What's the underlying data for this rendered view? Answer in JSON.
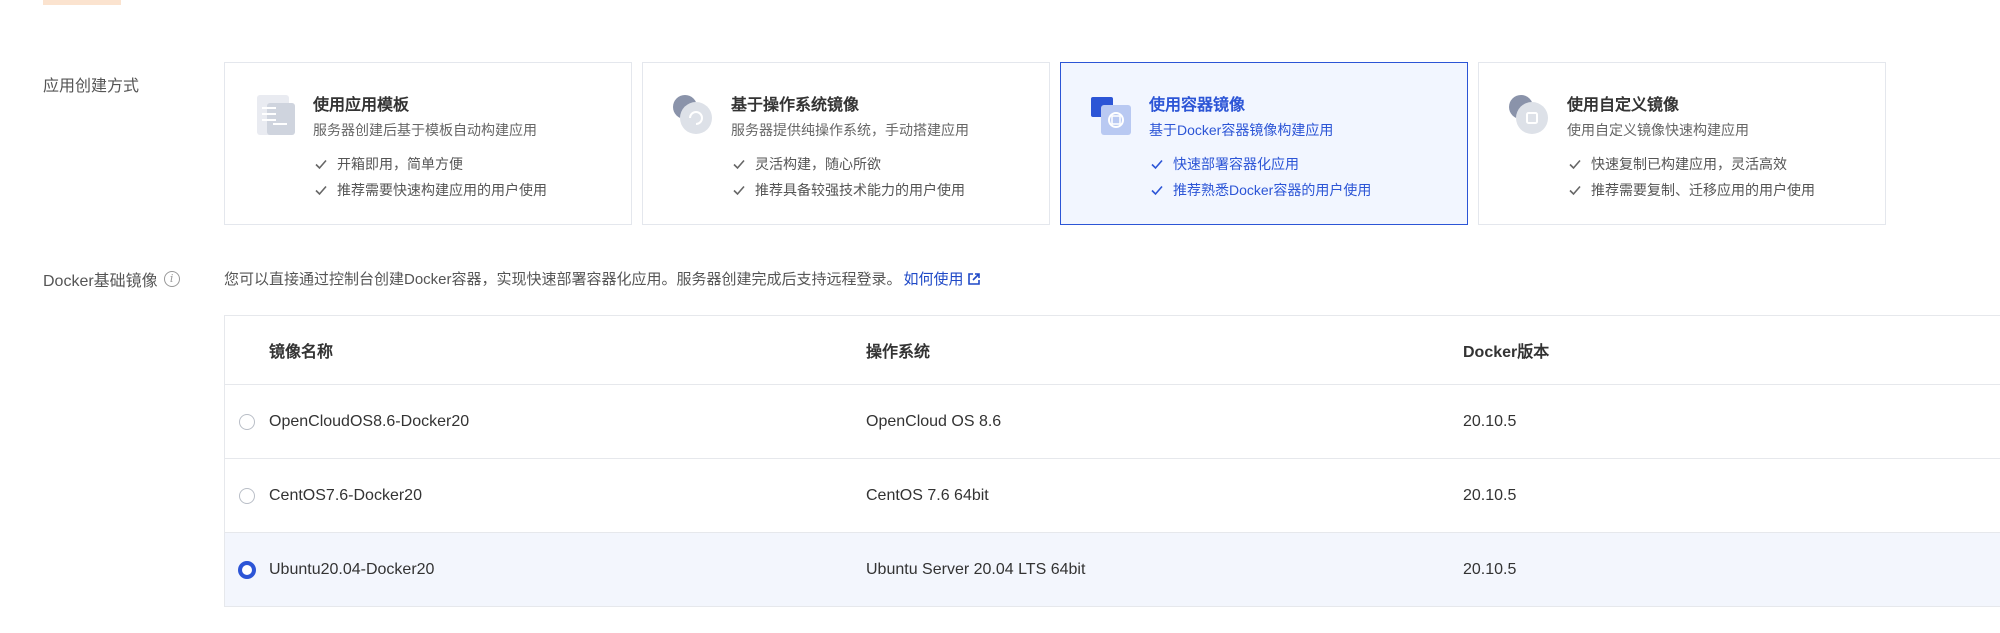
{
  "form": {
    "create_method_label": "应用创建方式",
    "docker_label": "Docker基础镜像",
    "docker_info_icon": "info-icon"
  },
  "cards": [
    {
      "title": "使用应用模板",
      "desc": "服务器创建后基于模板自动构建应用",
      "features": [
        "开箱即用，简单方便",
        "推荐需要快速构建应用的用户使用"
      ],
      "icon": "template-icon",
      "selected": false
    },
    {
      "title": "基于操作系统镜像",
      "desc": "服务器提供纯操作系统，手动搭建应用",
      "features": [
        "灵活构建，随心所欲",
        "推荐具备较强技术能力的用户使用"
      ],
      "icon": "os-image-icon",
      "selected": false
    },
    {
      "title": "使用容器镜像",
      "desc": "基于Docker容器镜像构建应用",
      "features": [
        "快速部署容器化应用",
        "推荐熟悉Docker容器的用户使用"
      ],
      "icon": "container-icon",
      "selected": true
    },
    {
      "title": "使用自定义镜像",
      "desc": "使用自定义镜像快速构建应用",
      "features": [
        "快速复制已构建应用，灵活高效",
        "推荐需要复制、迁移应用的用户使用"
      ],
      "icon": "custom-image-icon",
      "selected": false
    }
  ],
  "hint": {
    "text": "您可以直接通过控制台创建Docker容器，实现快速部署容器化应用。服务器创建完成后支持远程登录。",
    "link": "如何使用"
  },
  "table": {
    "headers": [
      "镜像名称",
      "操作系统",
      "Docker版本"
    ],
    "rows": [
      {
        "name": "OpenCloudOS8.6-Docker20",
        "os": "OpenCloud OS 8.6",
        "version": "20.10.5",
        "selected": false
      },
      {
        "name": "CentOS7.6-Docker20",
        "os": "CentOS 7.6 64bit",
        "version": "20.10.5",
        "selected": false
      },
      {
        "name": "Ubuntu20.04-Docker20",
        "os": "Ubuntu Server 20.04 LTS 64bit",
        "version": "20.10.5",
        "selected": true
      }
    ]
  },
  "colors": {
    "accent": "#2c55d6",
    "selected_bg": "#f2f6ff",
    "border": "#e4e7ed"
  }
}
